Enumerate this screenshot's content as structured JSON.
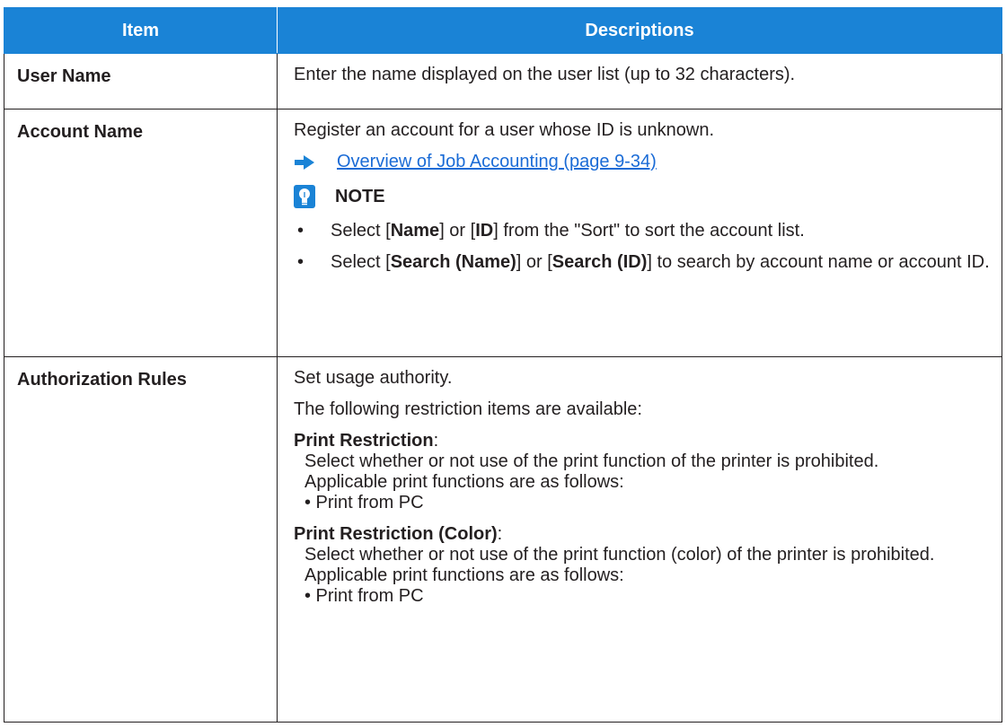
{
  "header": {
    "item": "Item",
    "descriptions": "Descriptions"
  },
  "rows": {
    "user_name": {
      "item": "User Name",
      "desc": "Enter the name displayed on the user list (up to 32 characters)."
    },
    "account_name": {
      "item": "Account Name",
      "desc": "Register an account for a user whose ID is unknown.",
      "link": "Overview of Job Accounting (page 9-34)",
      "note_label": "NOTE",
      "note1": {
        "a": "Select [",
        "b": "Name",
        "c": "] or [",
        "d": "ID",
        "e": "] from the \"Sort\" to sort the account list."
      },
      "note2": {
        "a": "Select [",
        "b": "Search (Name)",
        "c": "] or [",
        "d": "Search (ID)",
        "e": "] to search by account name or account ID."
      },
      "bullet": "•"
    },
    "authorization": {
      "item": "Authorization Rules",
      "p1": "Set usage authority.",
      "p2": "The following restriction items are available:",
      "print": {
        "head": "Print Restriction",
        "line1": "Select whether or not use of the print function of the printer is prohibited.",
        "line2": "Applicable print functions are as follows:",
        "line3": "• Print from PC"
      },
      "print_color": {
        "head": "Print Restriction (Color)",
        "line1": "Select whether or not use of the print function (color) of the printer is prohibited.",
        "line2": "Applicable print functions are as follows:",
        "line3": "• Print from PC"
      },
      "colon": ":"
    }
  },
  "colors": {
    "header_bg": "#1a83d6",
    "link": "#1a6bd6",
    "text": "#231f20"
  },
  "icons": {
    "link_arrow": "arrow-right-icon",
    "note": "lightbulb-icon"
  }
}
